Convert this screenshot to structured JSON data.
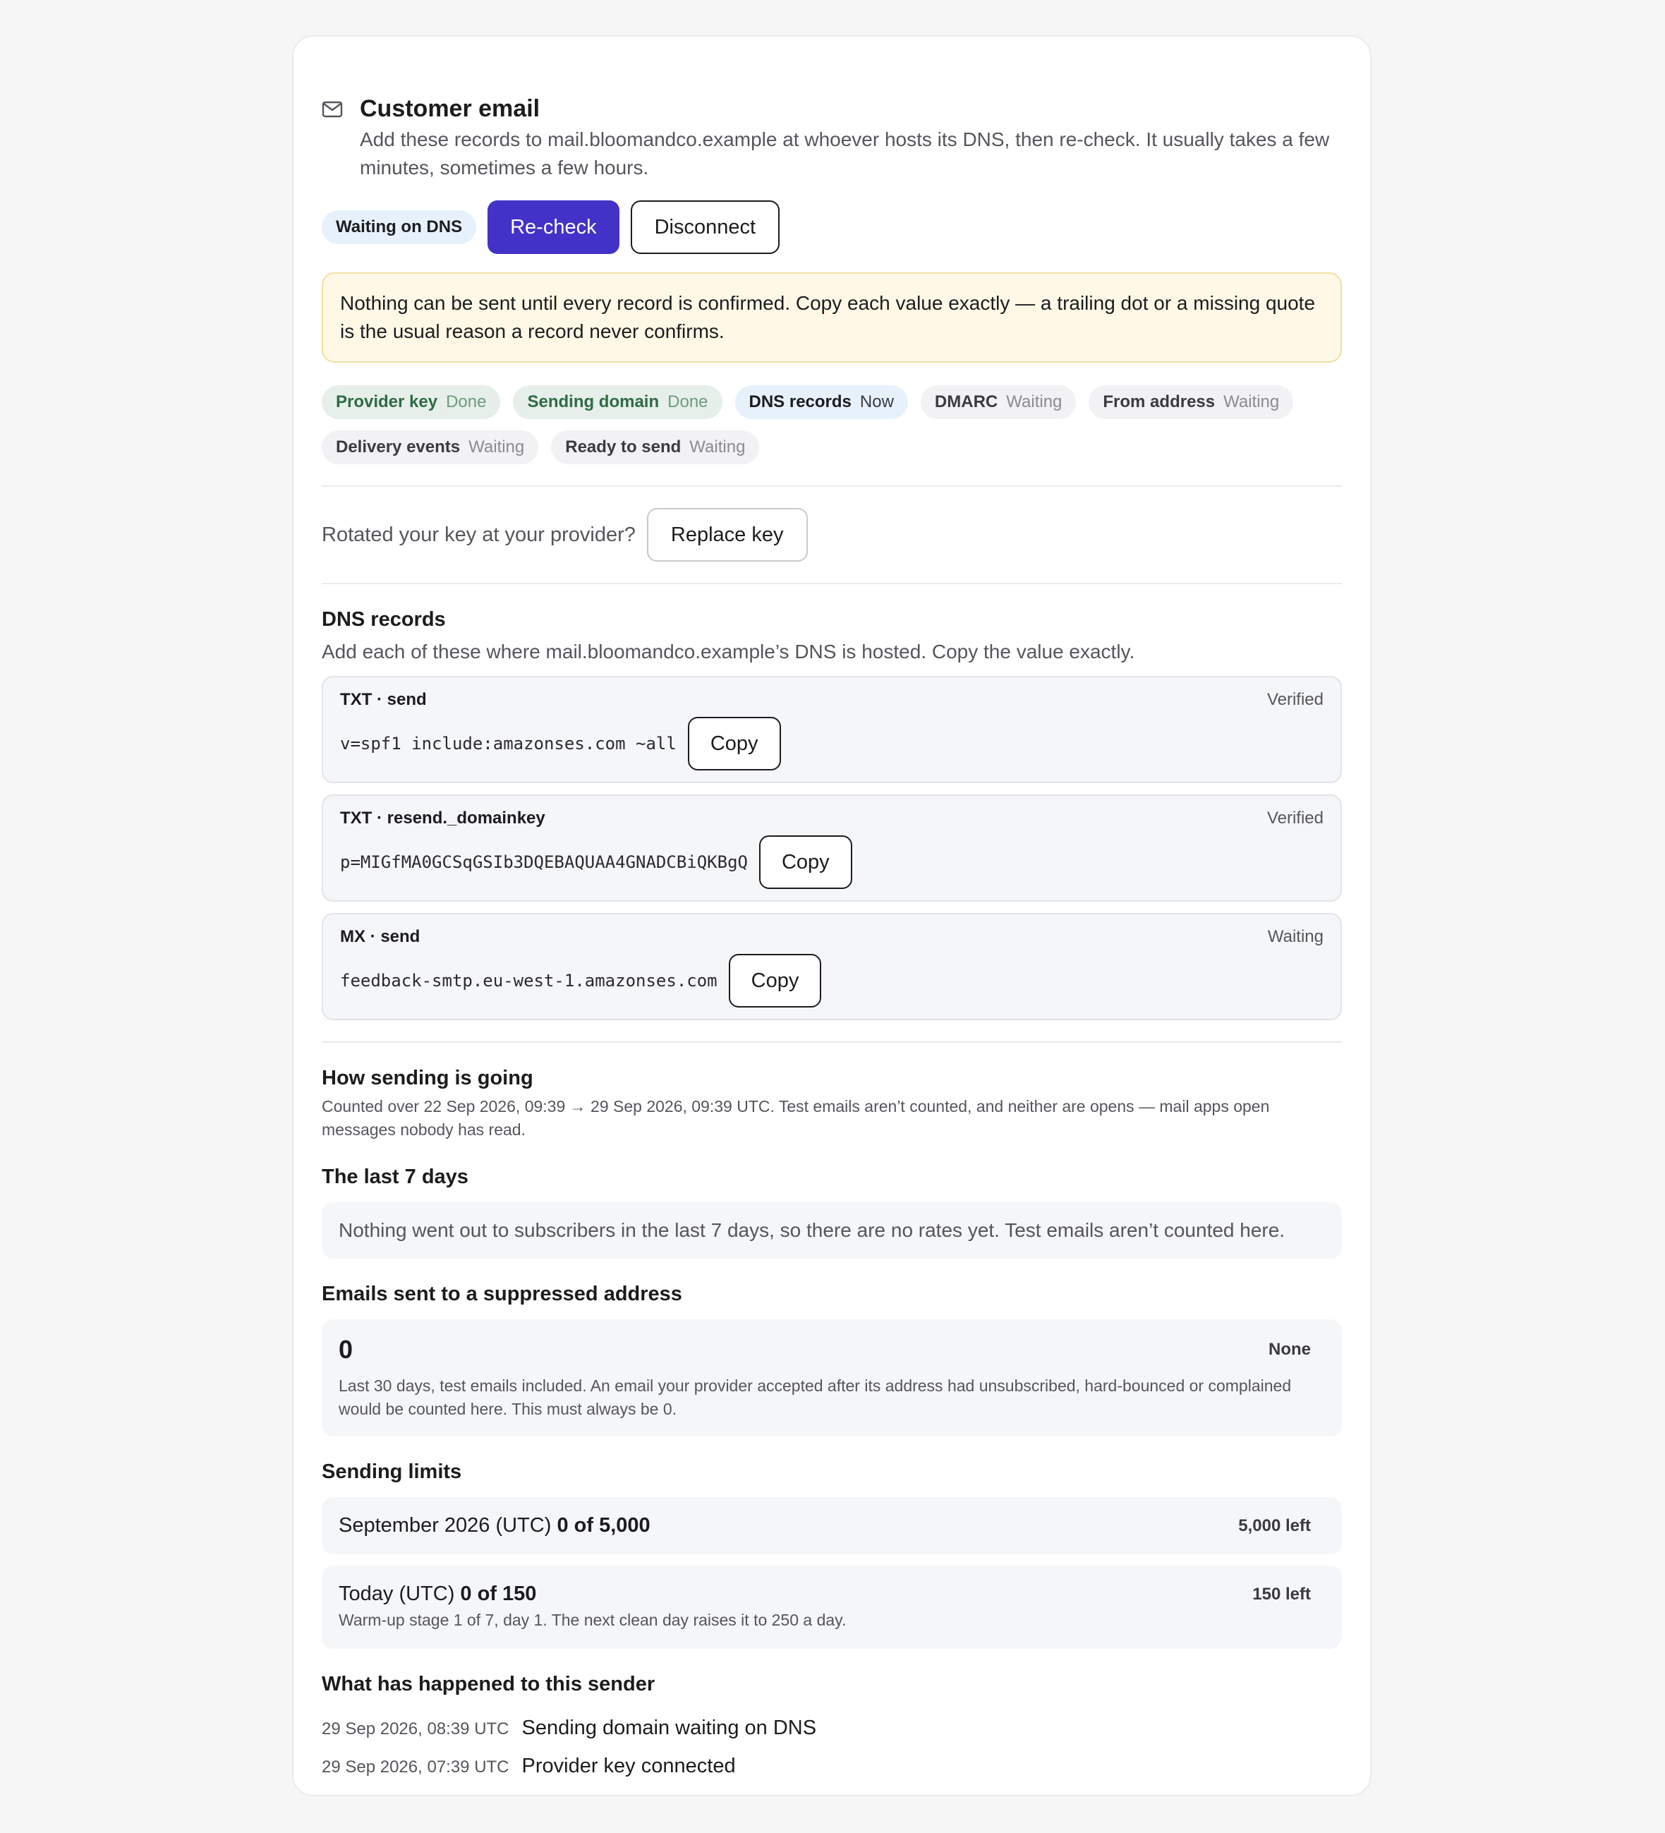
{
  "header": {
    "icon": "mail-icon",
    "title": "Customer email",
    "subtitle": "Add these records to mail.bloomandco.example at whoever hosts its DNS, then re-check. It usually takes a few minutes, sometimes a few hours."
  },
  "actions": {
    "status_badge": "Waiting on DNS",
    "recheck_label": "Re-check",
    "disconnect_label": "Disconnect"
  },
  "alert": "Nothing can be sent until every record is confirmed. Copy each value exactly — a trailing dot or a missing quote is the usual reason a record never confirms.",
  "steps": [
    {
      "name": "Provider key",
      "status": "Done"
    },
    {
      "name": "Sending domain",
      "status": "Done"
    },
    {
      "name": "DNS records",
      "status": "Now"
    },
    {
      "name": "DMARC",
      "status": "Waiting"
    },
    {
      "name": "From address",
      "status": "Waiting"
    },
    {
      "name": "Delivery events",
      "status": "Waiting"
    },
    {
      "name": "Ready to send",
      "status": "Waiting"
    }
  ],
  "replace": {
    "prompt": "Rotated your key at your provider?",
    "button": "Replace key"
  },
  "dns": {
    "title": "DNS records",
    "description": "Add each of these where mail.bloomandco.example’s DNS is hosted. Copy the value exactly.",
    "copy_label": "Copy",
    "records": [
      {
        "kind": "TXT · send",
        "state": "Verified",
        "value": "v=spf1 include:amazonses.com ~all"
      },
      {
        "kind": "TXT · resend._domainkey",
        "state": "Verified",
        "value": "p=MIGfMA0GCSqGSIb3DQEBAQUAA4GNADCBiQKBgQ"
      },
      {
        "kind": "MX · send",
        "state": "Waiting",
        "value": "feedback-smtp.eu-west-1.amazonses.com"
      }
    ]
  },
  "sending": {
    "title": "How sending is going",
    "note": "Counted over 22 Sep 2026, 09:39 → 29 Sep 2026, 09:39 UTC. Test emails aren’t counted, and neither are opens — mail apps open messages nobody has read.",
    "last7_title": "The last 7 days",
    "last7_message": "Nothing went out to subscribers in the last 7 days, so there are no rates yet. Test emails aren’t counted here.",
    "suppressed_title": "Emails sent to a suppressed address",
    "suppressed_count": "0",
    "suppressed_state": "None",
    "suppressed_note": "Last 30 days, test emails included. An email your provider accepted after its address had unsubscribed, hard-bounced or complained would be counted here. This must always be 0."
  },
  "limits": {
    "title": "Sending limits",
    "month": {
      "label": "September 2026 (UTC)",
      "value": "0 of 5,000",
      "left": "5,000 left"
    },
    "today": {
      "label": "Today (UTC)",
      "value": "0 of 150",
      "left": "150 left",
      "note": "Warm-up stage 1 of 7, day 1. The next clean day raises it to 250 a day."
    }
  },
  "history": {
    "title": "What has happened to this sender",
    "events": [
      {
        "time": "29 Sep 2026, 08:39 UTC",
        "text": "Sending domain waiting on DNS"
      },
      {
        "time": "29 Sep 2026, 07:39 UTC",
        "text": "Provider key connected"
      }
    ]
  },
  "colors": {
    "accent": "#4332c7",
    "done_bg": "#e6efe9",
    "now_bg": "#e7f1fb",
    "alert_bg": "#fff8e6"
  }
}
